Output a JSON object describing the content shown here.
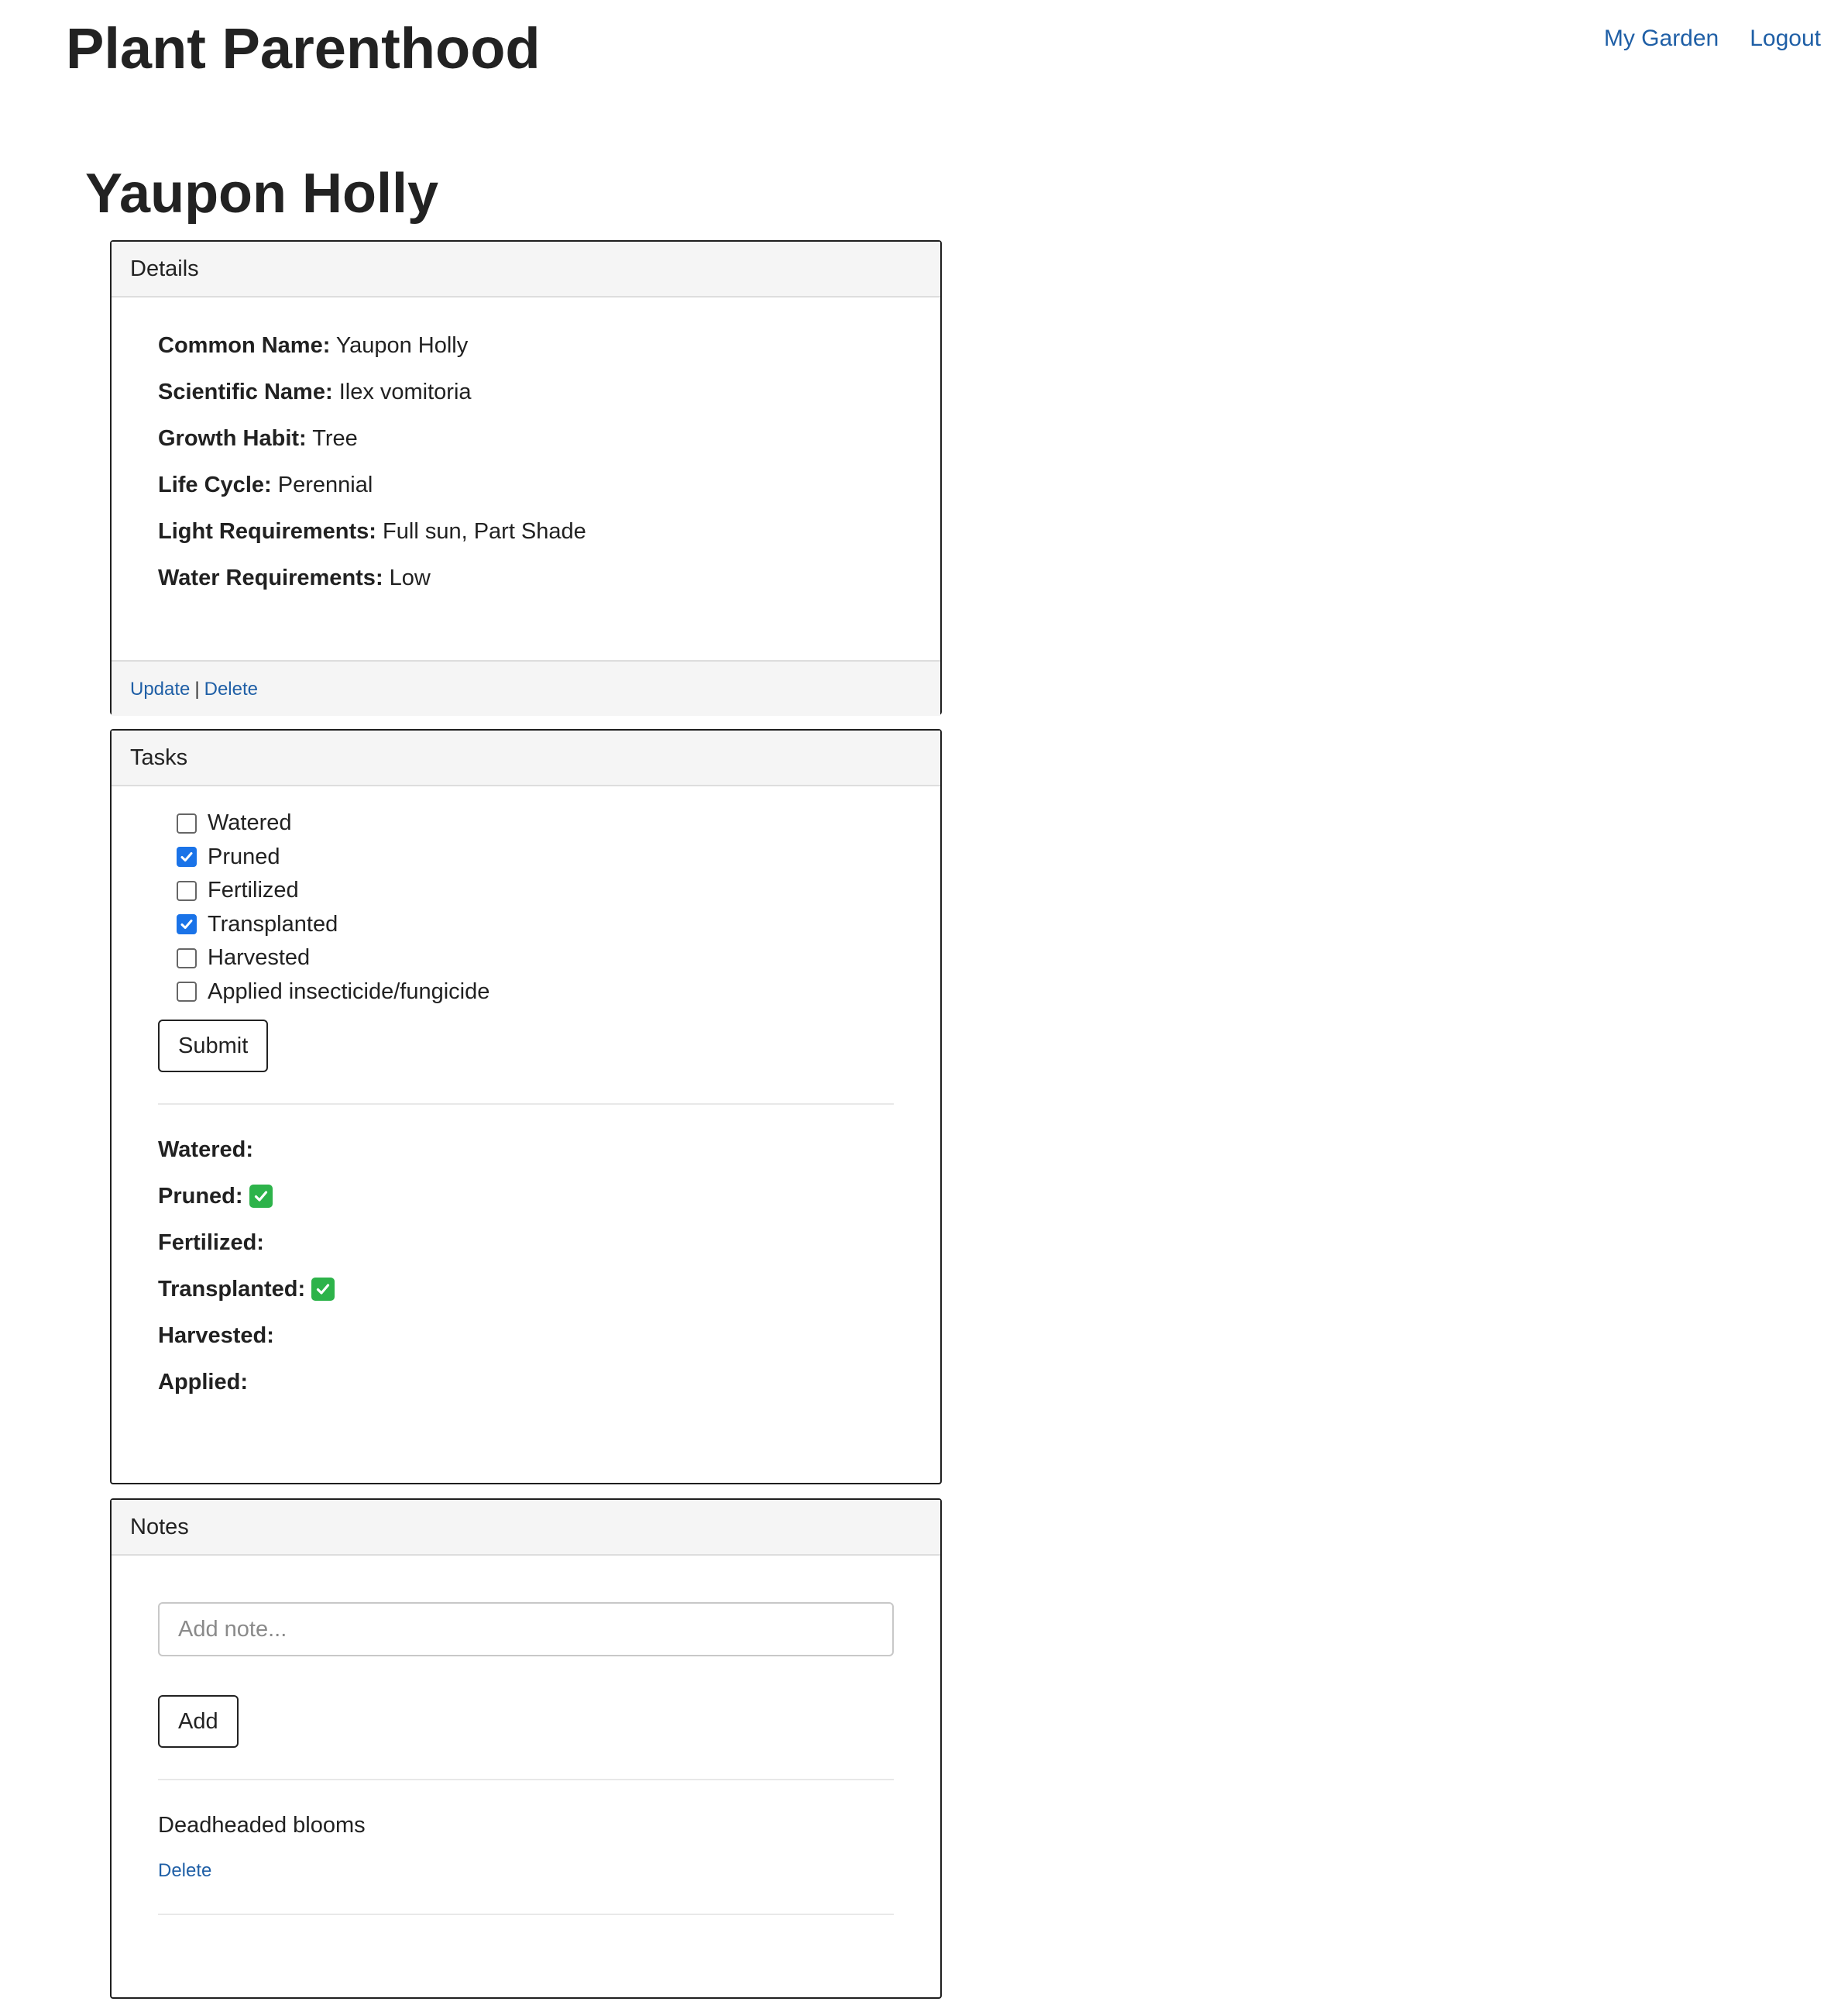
{
  "header": {
    "brand": "Plant Parenthood",
    "nav": [
      {
        "label": "My Garden"
      },
      {
        "label": "Logout"
      }
    ]
  },
  "page_title": "Yaupon Holly",
  "details": {
    "heading": "Details",
    "rows": [
      {
        "label": "Common Name:",
        "value": "Yaupon Holly"
      },
      {
        "label": "Scientific Name:",
        "value": "Ilex vomitoria"
      },
      {
        "label": "Growth Habit:",
        "value": "Tree"
      },
      {
        "label": "Life Cycle:",
        "value": "Perennial"
      },
      {
        "label": "Light Requirements:",
        "value": "Full sun, Part Shade"
      },
      {
        "label": "Water Requirements:",
        "value": "Low"
      }
    ],
    "footer": {
      "update_label": "Update",
      "separator": "|",
      "delete_label": "Delete"
    }
  },
  "tasks": {
    "heading": "Tasks",
    "items": [
      {
        "label": "Watered",
        "checked": false
      },
      {
        "label": "Pruned",
        "checked": true
      },
      {
        "label": "Fertilized",
        "checked": false
      },
      {
        "label": "Transplanted",
        "checked": true
      },
      {
        "label": "Harvested",
        "checked": false
      },
      {
        "label": "Applied insecticide/fungicide",
        "checked": false
      }
    ],
    "submit_label": "Submit",
    "status": [
      {
        "label": "Watered:",
        "done": false
      },
      {
        "label": "Pruned:",
        "done": true
      },
      {
        "label": "Fertilized:",
        "done": false
      },
      {
        "label": "Transplanted:",
        "done": true
      },
      {
        "label": "Harvested:",
        "done": false
      },
      {
        "label": "Applied:",
        "done": false
      }
    ],
    "done_icon": "check-mark-button-icon",
    "done_color": "#2db34a"
  },
  "notes": {
    "heading": "Notes",
    "input_placeholder": "Add note...",
    "input_value": "",
    "add_label": "Add",
    "items": [
      {
        "text": "Deadheaded blooms",
        "delete_label": "Delete"
      }
    ]
  },
  "colors": {
    "link": "#1f5fa6",
    "checkbox_checked": "#1a73e8",
    "panel_heading_bg": "#f5f5f5"
  }
}
